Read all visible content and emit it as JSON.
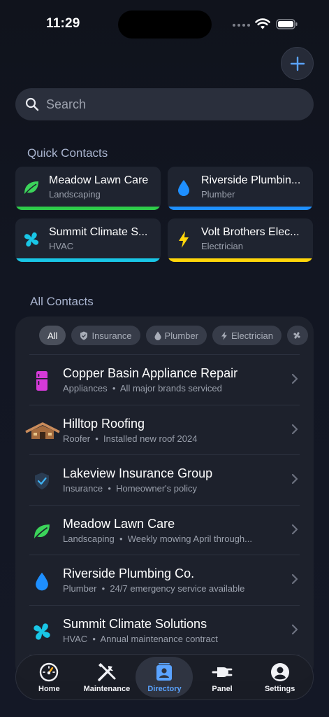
{
  "status": {
    "time": "11:29"
  },
  "search": {
    "placeholder": "Search"
  },
  "sections": {
    "quick": "Quick Contacts",
    "all": "All Contacts"
  },
  "quick_contacts": [
    {
      "name": "Meadow Lawn Care",
      "category": "Landscaping",
      "icon": "leaf-icon",
      "color": "#2ecc4a"
    },
    {
      "name": "Riverside Plumbin...",
      "category": "Plumber",
      "icon": "water-drop-icon",
      "color": "#1e8fff"
    },
    {
      "name": "Summit Climate S...",
      "category": "HVAC",
      "icon": "fan-icon",
      "color": "#19c6e6"
    },
    {
      "name": "Volt Brothers Elec...",
      "category": "Electrician",
      "icon": "bolt-icon",
      "color": "#ffd60a"
    }
  ],
  "filters": [
    "All",
    "Insurance",
    "Plumber",
    "Electrician"
  ],
  "contacts": [
    {
      "title": "Copper Basin Appliance Repair",
      "category": "Appliances",
      "note": "All major brands serviced",
      "icon": "appliance-icon"
    },
    {
      "title": "Hilltop Roofing",
      "category": "Roofer",
      "note": "Installed new roof 2024",
      "icon": "house-roof-icon"
    },
    {
      "title": "Lakeview Insurance Group",
      "category": "Insurance",
      "note": "Homeowner's policy",
      "icon": "shield-check-icon"
    },
    {
      "title": "Meadow Lawn Care",
      "category": "Landscaping",
      "note": "Weekly mowing April through...",
      "icon": "leaf-icon"
    },
    {
      "title": "Riverside Plumbing Co.",
      "category": "Plumber",
      "note": "24/7 emergency service available",
      "icon": "water-drop-icon"
    },
    {
      "title": "Summit Climate Solutions",
      "category": "HVAC",
      "note": "Annual maintenance contract",
      "icon": "fan-icon"
    }
  ],
  "tabs": [
    {
      "label": "Home",
      "icon": "gauge-icon"
    },
    {
      "label": "Maintenance",
      "icon": "tools-icon"
    },
    {
      "label": "Directory",
      "icon": "contact-card-icon",
      "active": true
    },
    {
      "label": "Panel",
      "icon": "plug-icon"
    },
    {
      "label": "Settings",
      "icon": "person-icon"
    }
  ],
  "colors": {
    "accent": "#5aa3ff",
    "background": "#121622"
  }
}
